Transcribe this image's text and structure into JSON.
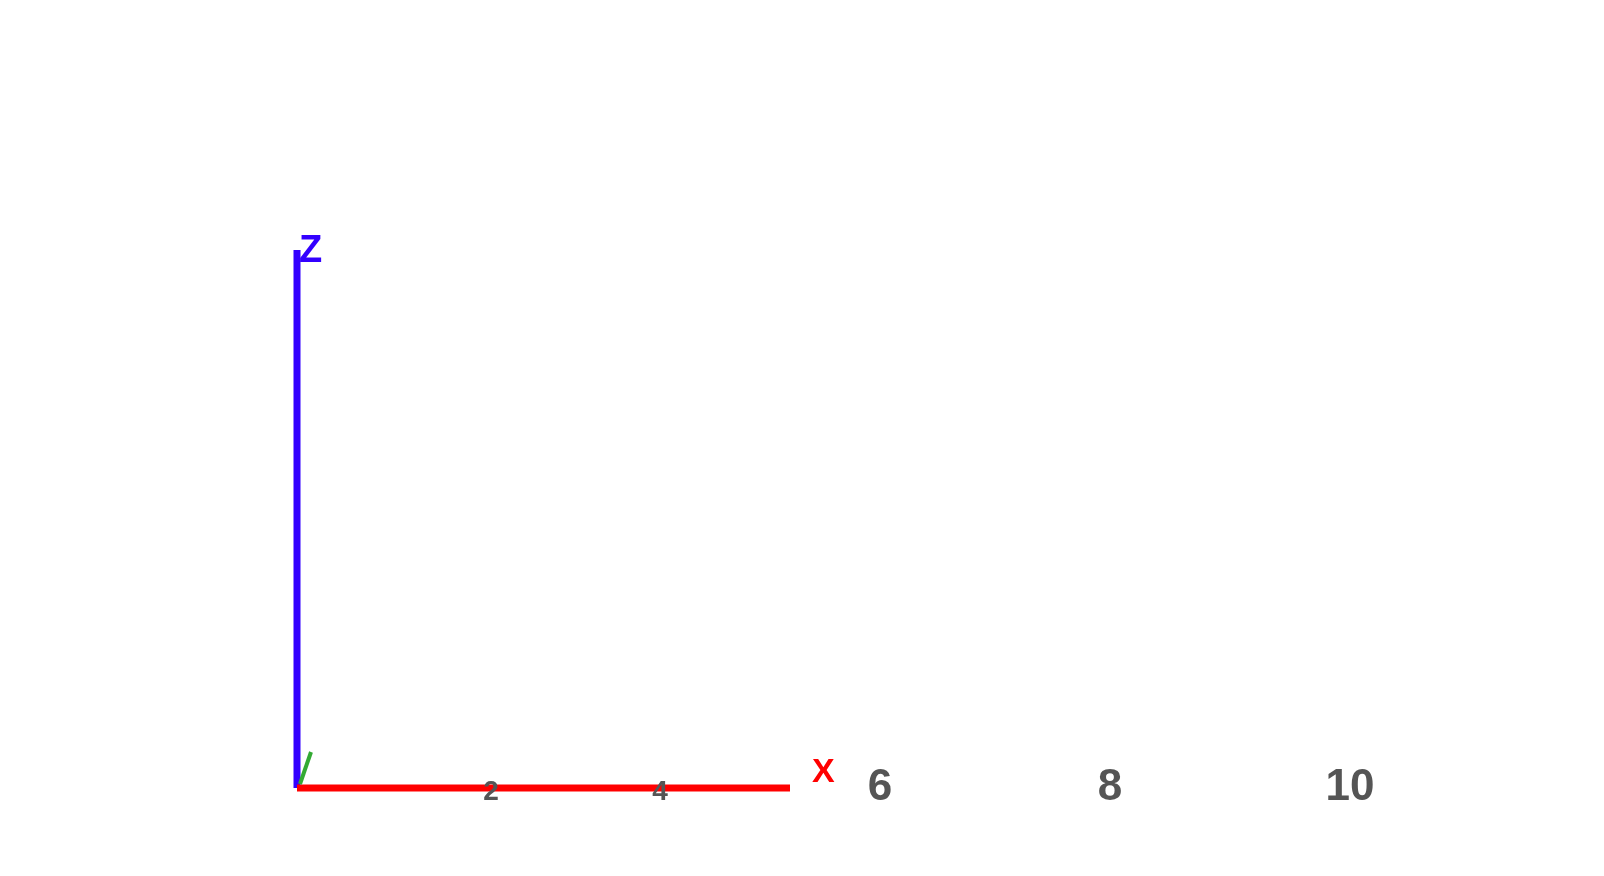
{
  "axes": [
    {
      "kind": "z",
      "label": "Z",
      "color": "#3300ff"
    },
    {
      "kind": "x",
      "label": "X",
      "color": "#ff0000"
    },
    {
      "kind": "y",
      "color": "#33aa33"
    }
  ],
  "x_ticks": [
    "2",
    "4",
    "6",
    "8",
    "10"
  ]
}
